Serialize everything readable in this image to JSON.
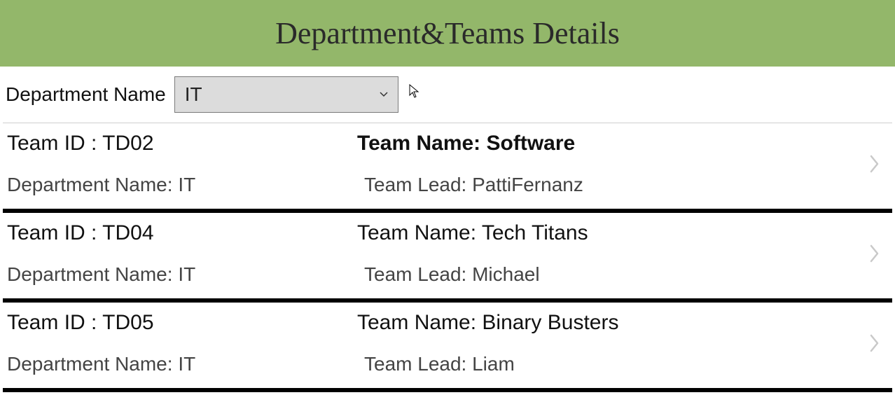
{
  "header": {
    "title": "Department&Teams Details"
  },
  "filter": {
    "label": "Department Name",
    "selected": "IT"
  },
  "labels": {
    "team_id_prefix": "Team ID : ",
    "team_name_prefix": "Team Name: ",
    "dept_prefix": "Department Name: ",
    "lead_prefix": "Team Lead: "
  },
  "teams": [
    {
      "id": "TD02",
      "name": "Software",
      "department": "IT",
      "lead": "PattiFernanz",
      "selected": true
    },
    {
      "id": "TD04",
      "name": "Tech Titans",
      "department": "IT",
      "lead": "Michael",
      "selected": false
    },
    {
      "id": "TD05",
      "name": "Binary Busters",
      "department": "IT",
      "lead": "Liam",
      "selected": false
    }
  ]
}
